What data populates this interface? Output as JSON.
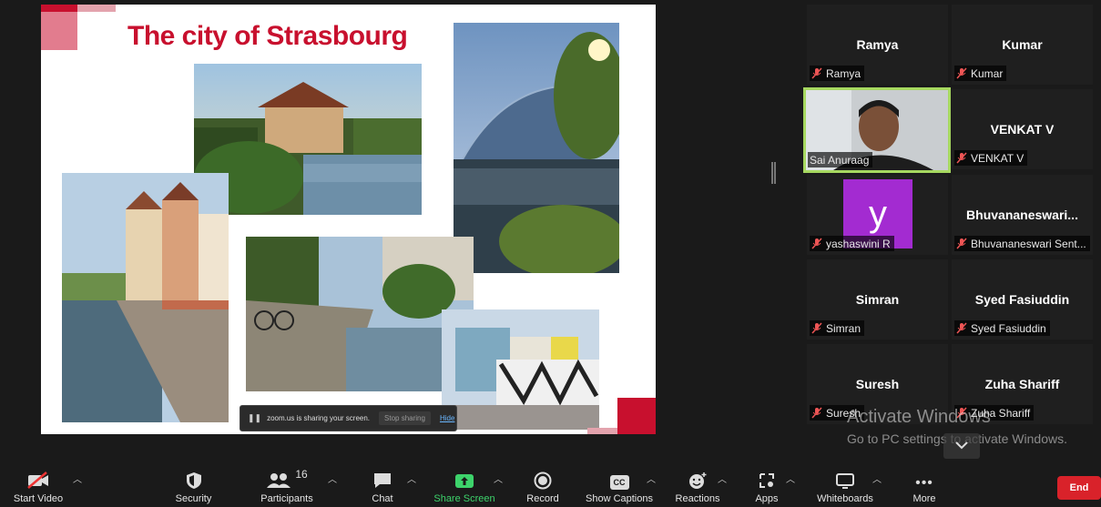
{
  "slide": {
    "title": "The city of Strasbourg"
  },
  "share_banner": {
    "text": "zoom.us is sharing your screen.",
    "stop_label": "Stop sharing",
    "hide_label": "Hide"
  },
  "participants": [
    {
      "name": "Ramya",
      "label": "Ramya"
    },
    {
      "name": "Kumar",
      "label": "Kumar"
    },
    {
      "name": "",
      "label": "Sai Anuraag"
    },
    {
      "name": "VENKAT V",
      "label": "VENKAT V"
    },
    {
      "name": "y",
      "label": "yashaswini R"
    },
    {
      "name": "Bhuvananeswari...",
      "label": "Bhuvananeswari Sent..."
    },
    {
      "name": "Simran",
      "label": "Simran"
    },
    {
      "name": "Syed Fasiuddin",
      "label": "Syed Fasiuddin"
    },
    {
      "name": "Suresh",
      "label": "Suresh"
    },
    {
      "name": "Zuha Shariff",
      "label": "Zuha Shariff"
    }
  ],
  "watermark": {
    "line1": "Activate Windows",
    "line2": "Go to PC settings to activate Windows."
  },
  "toolbar": {
    "start_video": "Start Video",
    "security": "Security",
    "participants": "Participants",
    "participants_count": "16",
    "chat": "Chat",
    "share_screen": "Share Screen",
    "record": "Record",
    "show_captions": "Show Captions",
    "cc": "CC",
    "reactions": "Reactions",
    "apps": "Apps",
    "whiteboards": "Whiteboards",
    "more": "More",
    "end": "End"
  },
  "colors": {
    "accent_red": "#c8102e",
    "active_speaker": "#a6d860",
    "share_green": "#3dd36b",
    "end_red": "#d9222a",
    "avatar_purple": "#a32bd1"
  }
}
